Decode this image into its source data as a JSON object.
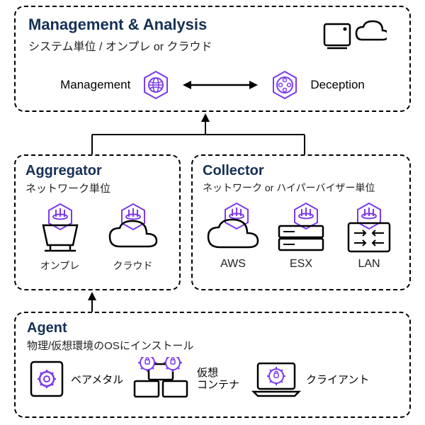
{
  "management": {
    "title": "Management & Analysis",
    "subtitle": "システム単位 / オンプレ or クラウド",
    "left_label": "Management",
    "right_label": "Deception"
  },
  "aggregator": {
    "title": "Aggregator",
    "subtitle": "ネットワーク単位",
    "onpre": "オンプレ",
    "cloud": "クラウド"
  },
  "collector": {
    "title": "Collector",
    "subtitle": "ネットワーク or ハイパーバイザー単位",
    "aws": "AWS",
    "esx": "ESX",
    "lan": "LAN"
  },
  "agent": {
    "title": "Agent",
    "subtitle": "物理/仮想環境のOSにインストール",
    "baremetal": "ベアメタル",
    "virtual_line1": "仮想",
    "virtual_line2": "コンテナ",
    "client": "クライアント"
  }
}
